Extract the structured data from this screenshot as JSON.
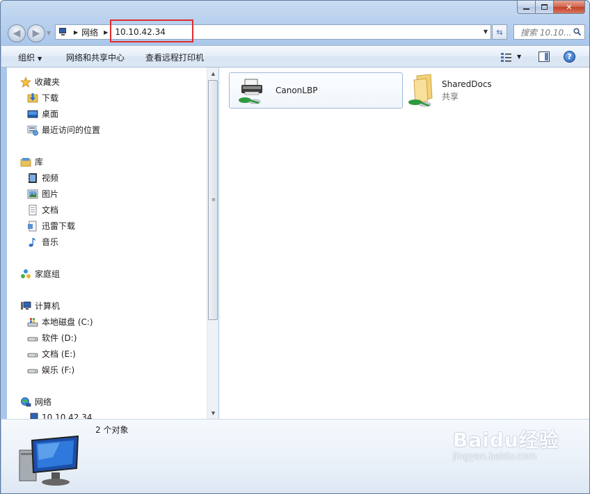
{
  "address_bar": {
    "breadcrumb_root": "网络",
    "current": "10.10.42.34"
  },
  "search": {
    "placeholder": "搜索 10.10..."
  },
  "toolbar": {
    "organize": "组织",
    "network_sharing_center": "网络和共享中心",
    "view_remote_printers": "查看远程打印机"
  },
  "sidebar": {
    "favorites": {
      "label": "收藏夹",
      "items": [
        {
          "label": "下载",
          "icon": "download-folder-icon"
        },
        {
          "label": "桌面",
          "icon": "desktop-icon"
        },
        {
          "label": "最近访问的位置",
          "icon": "recent-places-icon"
        }
      ]
    },
    "libraries": {
      "label": "库",
      "items": [
        {
          "label": "视频",
          "icon": "video-library-icon"
        },
        {
          "label": "图片",
          "icon": "pictures-library-icon"
        },
        {
          "label": "文档",
          "icon": "documents-library-icon"
        },
        {
          "label": "迅雷下载",
          "icon": "thunder-download-icon"
        },
        {
          "label": "音乐",
          "icon": "music-library-icon"
        }
      ]
    },
    "homegroup": {
      "label": "家庭组"
    },
    "computer": {
      "label": "计算机",
      "items": [
        {
          "label": "本地磁盘 (C:)",
          "icon": "system-drive-icon"
        },
        {
          "label": "软件 (D:)",
          "icon": "drive-icon"
        },
        {
          "label": "文档 (E:)",
          "icon": "drive-icon"
        },
        {
          "label": "娱乐 (F:)",
          "icon": "drive-icon"
        }
      ]
    },
    "network": {
      "label": "网络",
      "items": [
        {
          "label": "10.10.42.34"
        }
      ]
    }
  },
  "content": {
    "items": [
      {
        "name": "CanonLBP",
        "type": "shared-printer"
      },
      {
        "name": "SharedDocs",
        "subtitle": "共享",
        "type": "shared-folder"
      }
    ]
  },
  "details": {
    "count": "2 个对象"
  },
  "watermark": {
    "main": "Baidu经验",
    "sub": "jingyan.baidu.com"
  },
  "colors": {
    "highlight_box": "#e02b2b",
    "accent": "#3b6fb6"
  }
}
